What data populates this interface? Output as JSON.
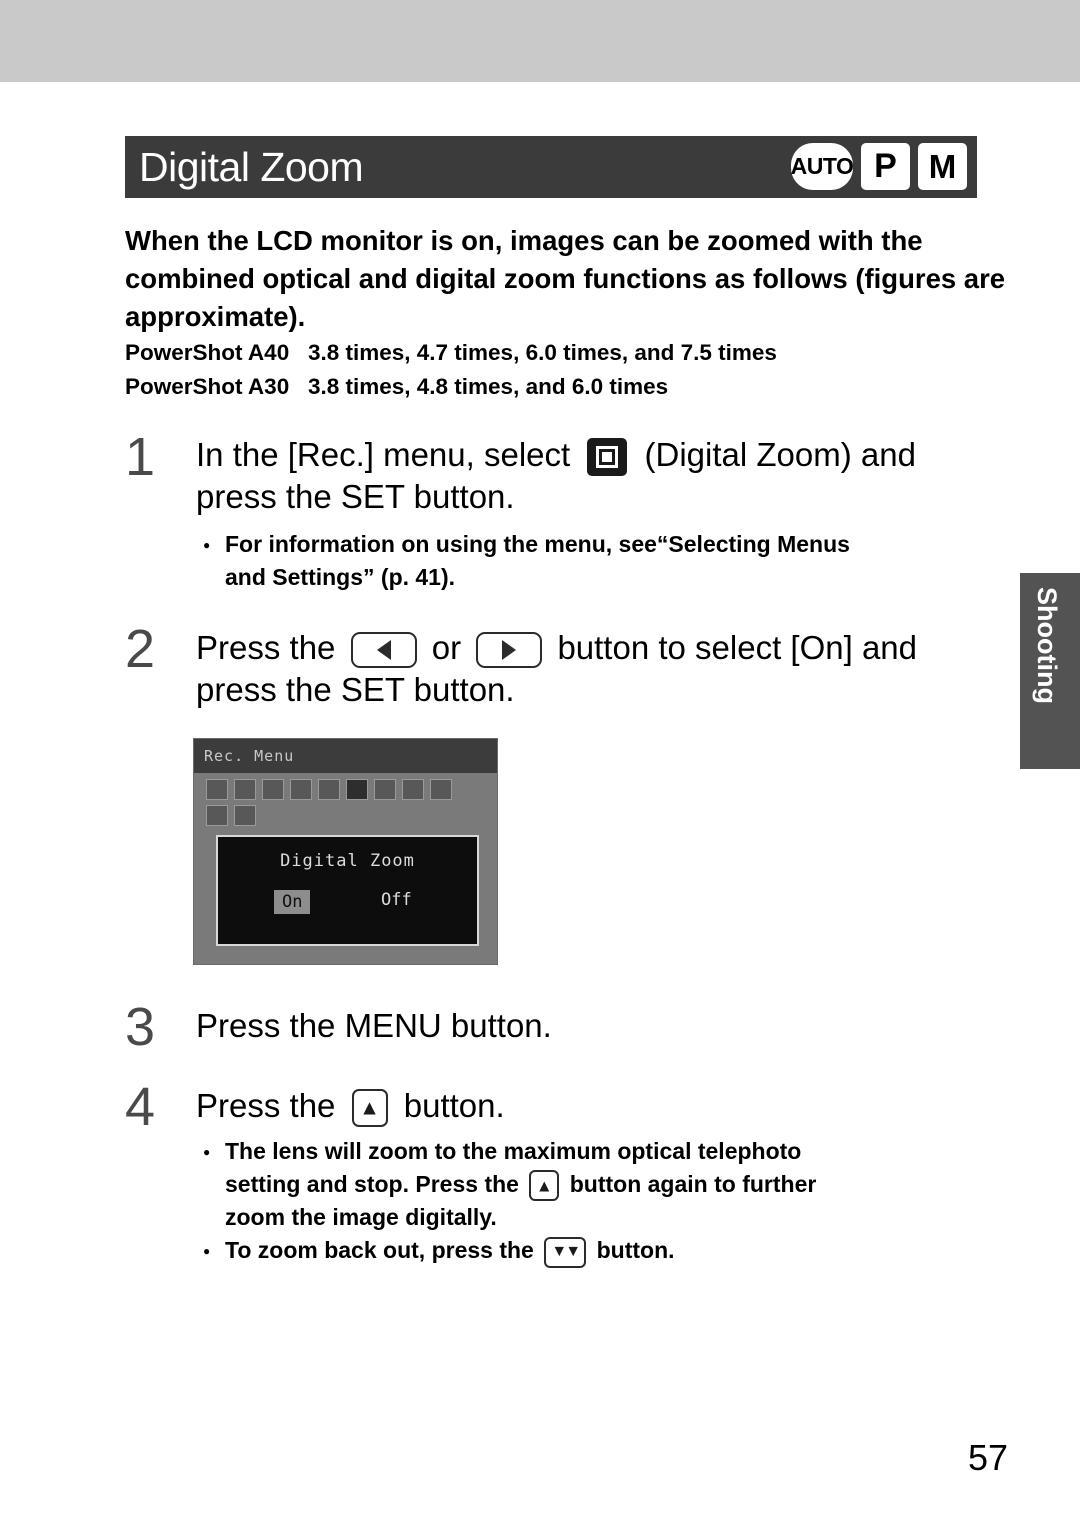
{
  "header": {
    "title": "Digital Zoom",
    "mode_icons": [
      {
        "name": "auto-mode-icon",
        "label": "AUTO"
      },
      {
        "name": "program-mode-icon",
        "label": "P"
      },
      {
        "name": "manual-mode-icon",
        "label": "M"
      }
    ]
  },
  "intro": "When the LCD monitor is on, images can be zoomed with the combined optical and digital zoom functions as follows (figures are approximate).",
  "specs": [
    "PowerShot A40   3.8 times, 4.7 times, 6.0 times, and 7.5 times",
    "PowerShot A30   3.8 times, 4.8 times, and 6.0 times"
  ],
  "steps": [
    {
      "number": "1",
      "text_before": "In the [Rec.] menu, select",
      "icon": "digital-zoom-menu-icon",
      "text_after": "(Digital Zoom) and press the SET button.",
      "notes": [
        "For information on using the menu, see “Selecting Menus and Settings” (p. 41)."
      ]
    },
    {
      "number": "2",
      "text_before": "Press the",
      "icon_left": "left-arrow-button-icon",
      "text_middle": "or",
      "icon_right": "right-arrow-button-icon",
      "text_after": "button to select [On] and press the SET button."
    },
    {
      "number": "3",
      "text": "Press the MENU button."
    },
    {
      "number": "4",
      "text_before": "Press the",
      "icon": "telephoto-zoom-button-icon",
      "text_after": "button.",
      "notes": [
        "The lens will zoom to the maximum optical telephoto setting and stop. Press the ▲ button again to further zoom the image digitally.",
        "To zoom back out, press the ▼ button."
      ]
    }
  ],
  "step2_label_or": "or",
  "step1_note_part1": "For information on using the menu, see",
  "step1_note_quote": "“Selecting Menus",
  "step1_note_part2": "and Settings”",
  "step1_note_page": "(p. 41).",
  "step4_note1_line1": "The lens will zoom to the maximum optical telephoto",
  "step4_note1_line2a": "setting and stop. Press the",
  "step4_note1_line2b": "button again to further",
  "step4_note1_line3": "zoom the image digitally.",
  "step4_note2a": "To zoom back out, press the",
  "step4_note2b": "button.",
  "lcd": {
    "title": "Rec. Menu",
    "setting_label": "Digital Zoom",
    "option_on": "On",
    "option_off": "Off"
  },
  "side_tab": {
    "label": "Shooting"
  },
  "page_number": "57",
  "colors": {
    "title_bar": "#3b3b3b",
    "top_band": "#c9c9c9",
    "side_tab": "#535353",
    "step_number": "#4a4a4a"
  }
}
